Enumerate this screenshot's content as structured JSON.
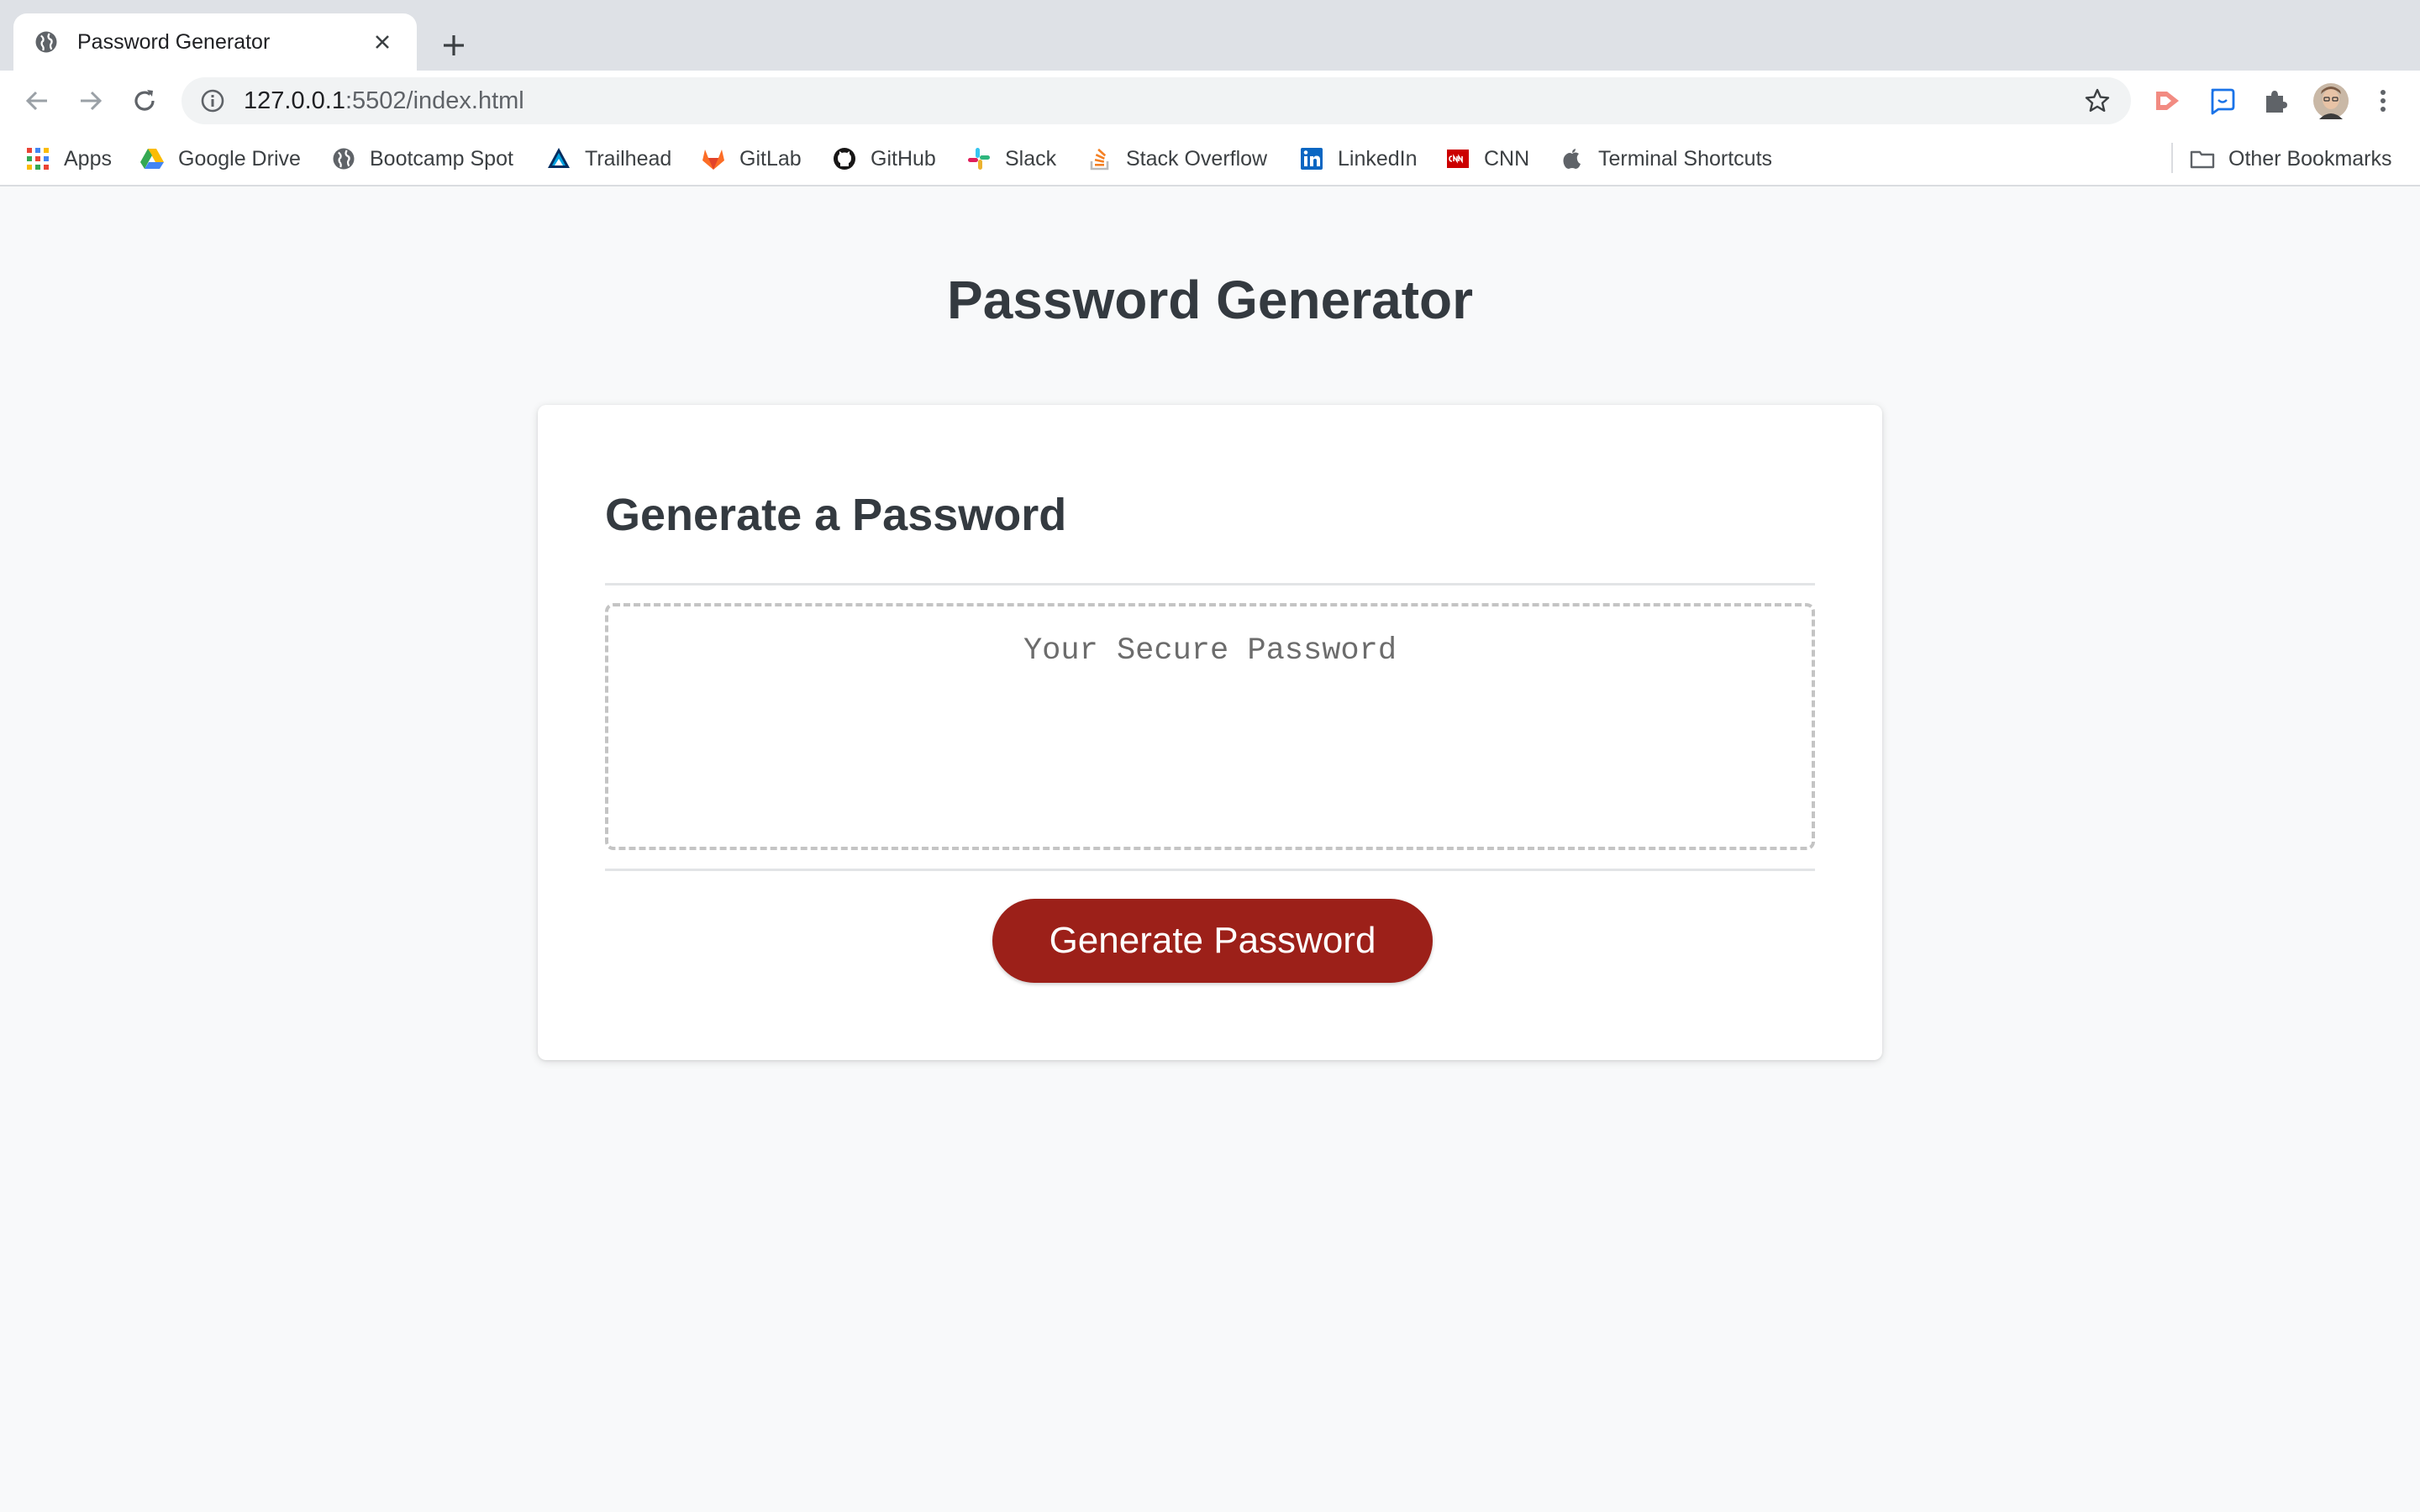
{
  "browser": {
    "tab": {
      "title": "Password Generator"
    },
    "address": {
      "host": "127.0.0.1",
      "path": ":5502/index.html"
    },
    "bookmarks": [
      {
        "label": "Apps",
        "icon": "apps-grid-icon"
      },
      {
        "label": "Google Drive",
        "icon": "google-drive-icon"
      },
      {
        "label": "Bootcamp Spot",
        "icon": "globe-icon"
      },
      {
        "label": "Trailhead",
        "icon": "trailhead-icon"
      },
      {
        "label": "GitLab",
        "icon": "gitlab-icon"
      },
      {
        "label": "GitHub",
        "icon": "github-icon"
      },
      {
        "label": "Slack",
        "icon": "slack-icon"
      },
      {
        "label": "Stack Overflow",
        "icon": "stackoverflow-icon"
      },
      {
        "label": "LinkedIn",
        "icon": "linkedin-icon"
      },
      {
        "label": "CNN",
        "icon": "cnn-icon"
      },
      {
        "label": "Terminal Shortcuts",
        "icon": "apple-icon"
      }
    ],
    "other_bookmarks": "Other Bookmarks"
  },
  "page": {
    "title": "Password Generator",
    "card": {
      "header": "Generate a Password",
      "password_placeholder": "Your Secure Password",
      "button_label": "Generate Password"
    }
  },
  "colors": {
    "button": "#9c2019",
    "heading": "#343a40",
    "background": "#f8f9fa"
  }
}
